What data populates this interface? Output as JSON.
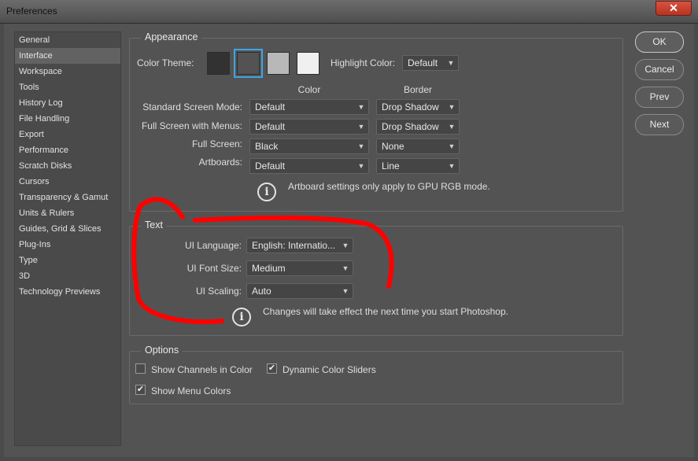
{
  "window": {
    "title": "Preferences",
    "close_glyph": "✕"
  },
  "sidebar": {
    "items": [
      {
        "label": "General"
      },
      {
        "label": "Interface"
      },
      {
        "label": "Workspace"
      },
      {
        "label": "Tools"
      },
      {
        "label": "History Log"
      },
      {
        "label": "File Handling"
      },
      {
        "label": "Export"
      },
      {
        "label": "Performance"
      },
      {
        "label": "Scratch Disks"
      },
      {
        "label": "Cursors"
      },
      {
        "label": "Transparency & Gamut"
      },
      {
        "label": "Units & Rulers"
      },
      {
        "label": "Guides, Grid & Slices"
      },
      {
        "label": "Plug-Ins"
      },
      {
        "label": "Type"
      },
      {
        "label": "3D"
      },
      {
        "label": "Technology Previews"
      }
    ],
    "selected": "Interface"
  },
  "appearance": {
    "legend": "Appearance",
    "color_theme_label": "Color Theme:",
    "themes": [
      {
        "name": "darkest",
        "color": "#323232"
      },
      {
        "name": "dark",
        "color": "#535353"
      },
      {
        "name": "medium",
        "color": "#b8b8b8"
      },
      {
        "name": "light",
        "color": "#f0f0f0"
      }
    ],
    "selected_theme": "dark",
    "highlight_label": "Highlight Color:",
    "highlight_value": "Default",
    "col_color": "Color",
    "col_border": "Border",
    "rows": [
      {
        "label": "Standard Screen Mode:",
        "color": "Default",
        "border": "Drop Shadow"
      },
      {
        "label": "Full Screen with Menus:",
        "color": "Default",
        "border": "Drop Shadow"
      },
      {
        "label": "Full Screen:",
        "color": "Black",
        "border": "None"
      },
      {
        "label": "Artboards:",
        "color": "Default",
        "border": "Line"
      }
    ],
    "note": "Artboard settings only apply to GPU RGB mode."
  },
  "text": {
    "legend": "Text",
    "ui_language_label": "UI Language:",
    "ui_language_value": "English: Internatio...",
    "ui_font_size_label": "UI Font Size:",
    "ui_font_size_value": "Medium",
    "ui_scaling_label": "UI Scaling:",
    "ui_scaling_value": "Auto",
    "note": "Changes will take effect the next time you start Photoshop."
  },
  "options": {
    "legend": "Options",
    "show_channels_in_color": {
      "label": "Show Channels in Color",
      "checked": false
    },
    "dynamic_color_sliders": {
      "label": "Dynamic Color Sliders",
      "checked": true
    },
    "show_menu_colors": {
      "label": "Show Menu Colors",
      "checked": true
    }
  },
  "buttons": {
    "ok": "OK",
    "cancel": "Cancel",
    "prev": "Prev",
    "next": "Next"
  },
  "icons": {
    "chevron": "chevron-down-icon",
    "info": "info-icon",
    "check": "checkmark-icon"
  },
  "colors": {
    "accent": "#3fa4e6",
    "annotation": "#ff0000"
  }
}
